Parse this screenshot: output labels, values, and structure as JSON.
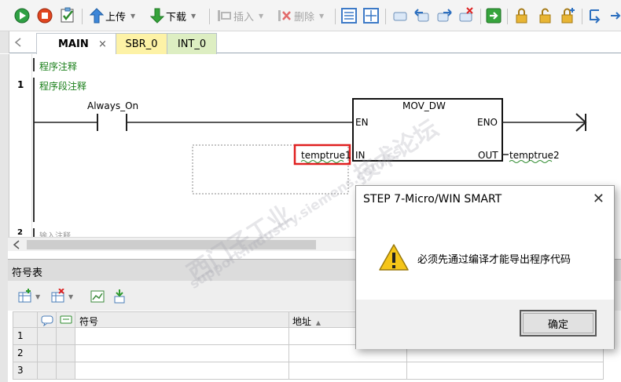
{
  "toolbar": {
    "upload_label": "上传",
    "download_label": "下载",
    "insert_label": "插入",
    "delete_label": "删除"
  },
  "tabs": [
    {
      "label": "MAIN",
      "close": "×"
    },
    {
      "label": "SBR_0"
    },
    {
      "label": "INT_0"
    }
  ],
  "editor": {
    "program_comment": "程序注释",
    "network_number": "1",
    "network_comment": "程序段注释",
    "contact_label": "Always_On",
    "block_title": "MOV_DW",
    "pin_en": "EN",
    "pin_eno": "ENO",
    "pin_in": "IN",
    "pin_out": "OUT",
    "in_operand": "temptrue1",
    "out_operand": "temptrue2",
    "next_network_number": "2",
    "next_network_comment": "输入注释"
  },
  "symbol_table": {
    "title": "符号表",
    "col_symbol": "符号",
    "col_address": "地址",
    "sort_indicator": "▲",
    "rows": [
      "1",
      "2",
      "3"
    ]
  },
  "dialog": {
    "title": "STEP 7-Micro/WIN SMART",
    "close": "✕",
    "message": "必须先通过编译才能导出程序代码",
    "ok_label": "确定"
  },
  "watermark": {
    "line1": "西门子工业",
    "line2": "support.industry.siemens.com/cs",
    "line3": "技术论坛"
  },
  "colors": {
    "comment_green": "#1a7f1a",
    "highlight_red": "#e02020",
    "sbr_tab": "#fdf2a6",
    "int_tab": "#ddeec2"
  }
}
